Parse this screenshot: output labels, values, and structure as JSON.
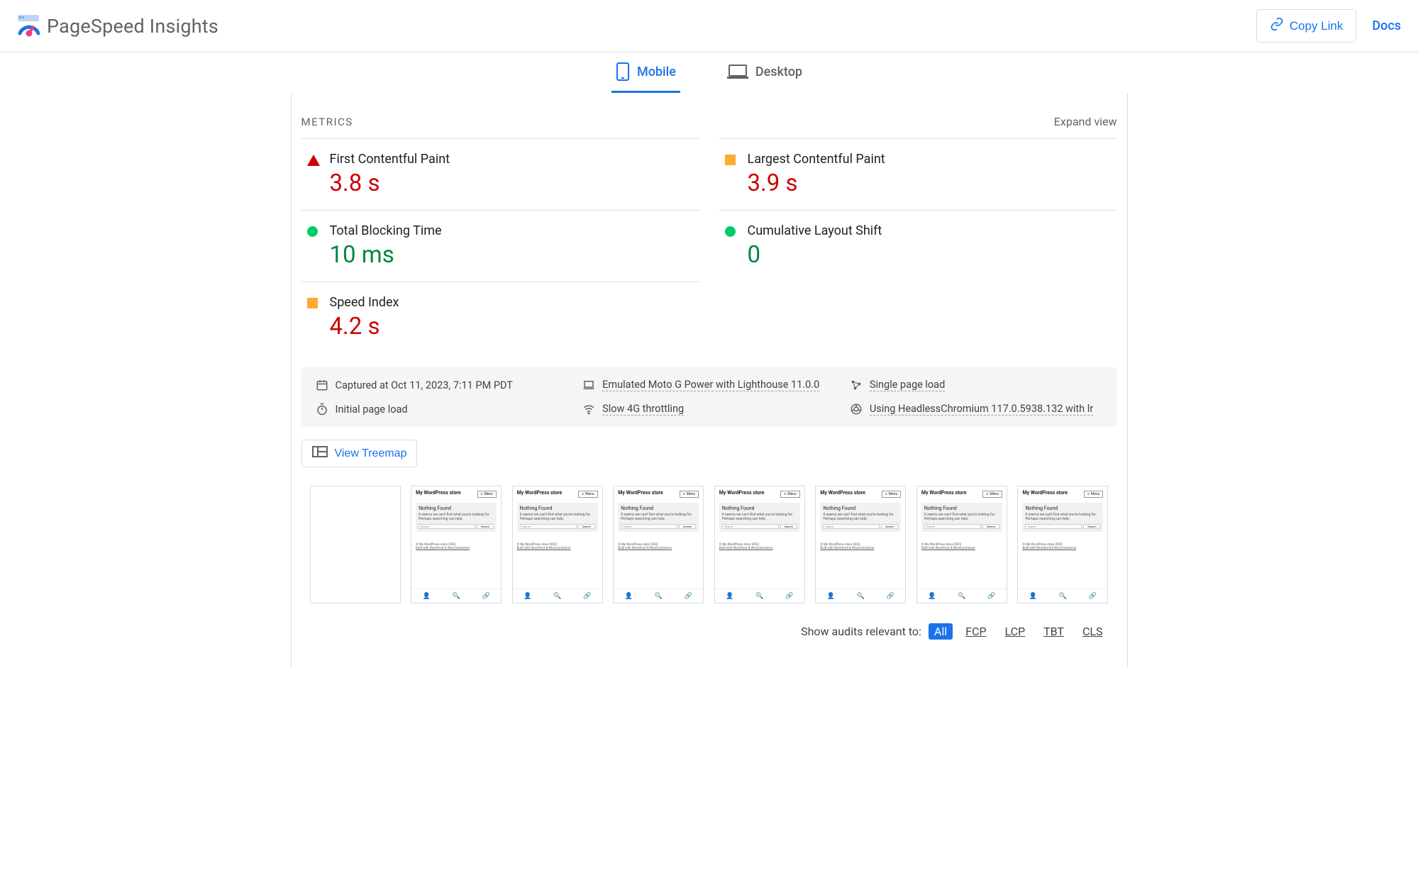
{
  "header": {
    "app_title": "PageSpeed Insights",
    "copy_link_label": "Copy Link",
    "docs_label": "Docs"
  },
  "tabs": {
    "mobile": "Mobile",
    "desktop": "Desktop",
    "active": "mobile"
  },
  "metrics_section": {
    "title": "METRICS",
    "expand_label": "Expand view"
  },
  "metrics": {
    "fcp": {
      "label": "First Contentful Paint",
      "value": "3.8 s",
      "status": "fail"
    },
    "lcp": {
      "label": "Largest Contentful Paint",
      "value": "3.9 s",
      "status": "warn"
    },
    "tbt": {
      "label": "Total Blocking Time",
      "value": "10 ms",
      "status": "pass"
    },
    "cls": {
      "label": "Cumulative Layout Shift",
      "value": "0",
      "status": "pass"
    },
    "si": {
      "label": "Speed Index",
      "value": "4.2 s",
      "status": "warn"
    }
  },
  "env": {
    "captured": "Captured at Oct 11, 2023, 7:11 PM PDT",
    "emulated": "Emulated Moto G Power with Lighthouse 11.0.0",
    "single_load": "Single page load",
    "initial_load": "Initial page load",
    "throttling": "Slow 4G throttling",
    "browser": "Using HeadlessChromium 117.0.5938.132 with lr"
  },
  "treemap": {
    "label": "View Treemap"
  },
  "filmstrip": {
    "site_title": "My WordPress store",
    "menu_label": "Menu",
    "nothing_found": "Nothing Found",
    "nothing_desc": "It seems we can't find what you're looking for. Perhaps searching can help.",
    "search_placeholder": "Search",
    "search_btn": "Search",
    "footer_line1": "© My WordPress store 2023",
    "footer_line2": "Built with Storefront & WooCommerce"
  },
  "filter": {
    "label": "Show audits relevant to:",
    "chips": [
      "All",
      "FCP",
      "LCP",
      "TBT",
      "CLS"
    ],
    "active": "All"
  },
  "colors": {
    "primary": "#1a73e8",
    "fail": "#cc0000",
    "warn": "#ffaa33",
    "pass": "#018642"
  }
}
